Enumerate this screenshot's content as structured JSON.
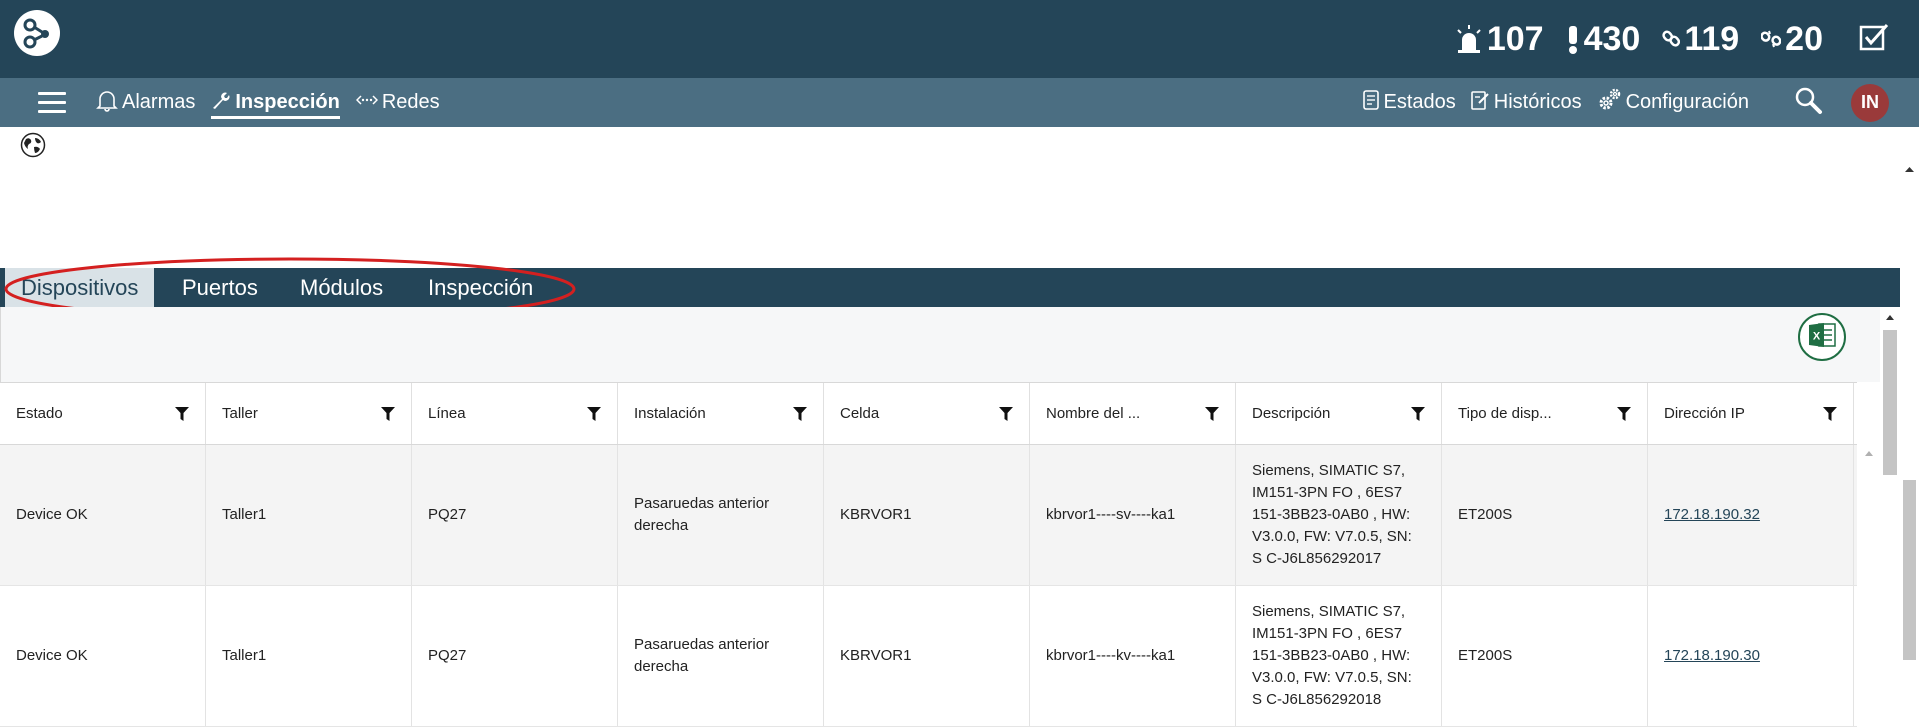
{
  "topbar": {
    "logo_icon": "network-logo-icon",
    "counters": [
      {
        "icon": "siren-alarm-icon",
        "value": "107"
      },
      {
        "icon": "exclamation-icon",
        "value": "430"
      },
      {
        "icon": "link-icon",
        "value": "119"
      },
      {
        "icon": "broken-link-icon",
        "value": "20"
      }
    ],
    "checkbox_icon": "checkbox-icon"
  },
  "nav": {
    "menu_icon": "hamburger-icon",
    "left": [
      {
        "label": "Alarmas",
        "icon": "bell-icon",
        "active": false
      },
      {
        "label": "Inspección",
        "icon": "wrench-icon",
        "active": true
      },
      {
        "label": "Redes",
        "icon": "network-arrows-icon",
        "active": false
      }
    ],
    "right": [
      {
        "label": "Estados",
        "icon": "report-icon"
      },
      {
        "label": "Históricos",
        "icon": "edit-doc-icon"
      },
      {
        "label": "Configuración",
        "icon": "gears-icon"
      }
    ],
    "search_icon": "search-icon",
    "avatar": "IN"
  },
  "tabs": [
    {
      "label": "Dispositivos",
      "active": true
    },
    {
      "label": "Puertos",
      "active": false
    },
    {
      "label": "Módulos",
      "active": false
    },
    {
      "label": "Inspección",
      "active": false
    }
  ],
  "table": {
    "columns": [
      "Estado",
      "Taller",
      "Línea",
      "Instalación",
      "Celda",
      "Nombre del ...",
      "Descripción",
      "Tipo de disp...",
      "Dirección IP"
    ],
    "rows": [
      [
        "Device OK",
        "Taller1",
        "PQ27",
        "Pasaruedas anterior derecha",
        "KBRVOR1",
        "kbrvor1----sv----ka1",
        "Siemens, SIMATIC S7, IM151-3PN FO , 6ES7 151-3BB23-0AB0 , HW: V3.0.0, FW: V7.0.5, SN: S C-J6L856292017",
        "ET200S",
        "172.18.190.32"
      ],
      [
        "Device OK",
        "Taller1",
        "PQ27",
        "Pasaruedas anterior derecha",
        "KBRVOR1",
        "kbrvor1----kv----ka1",
        "Siemens, SIMATIC S7, IM151-3PN FO , 6ES7 151-3BB23-0AB0 , HW: V3.0.0, FW: V7.0.5, SN: S C-J6L856292018",
        "ET200S",
        "172.18.190.30"
      ]
    ]
  },
  "colors": {
    "topbar": "#244558",
    "navbar": "#4b6e82",
    "highlight": "#d42020",
    "avatar": "#9a3a3a",
    "excel": "#1f6e43"
  }
}
